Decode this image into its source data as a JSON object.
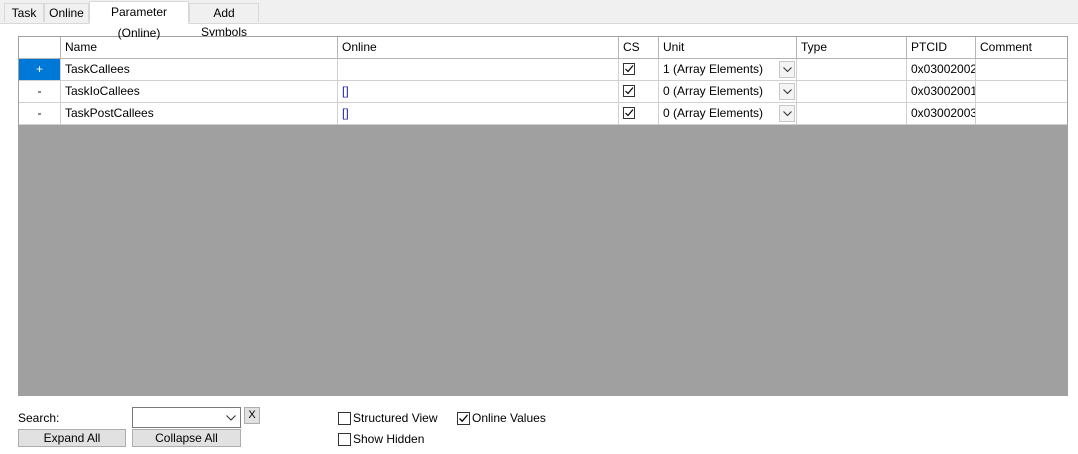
{
  "tabs": [
    {
      "label": "Task"
    },
    {
      "label": "Online"
    },
    {
      "label": "Parameter (Online)",
      "active": true
    },
    {
      "label": "Add Symbols"
    }
  ],
  "grid": {
    "columns": [
      "",
      "Name",
      "Online",
      "CS",
      "Unit",
      "Type",
      "PTCID",
      "Comment"
    ],
    "rows": [
      {
        "expander": "+",
        "name": "TaskCallees",
        "online": "",
        "cs": true,
        "unit": "1 (Array Elements)",
        "type": "",
        "ptcid": "0x03002002",
        "comment": "",
        "selected": true
      },
      {
        "expander": "-",
        "name": "TaskIoCallees",
        "online": "[]",
        "cs": true,
        "unit": "0 (Array Elements)",
        "type": "",
        "ptcid": "0x03002001",
        "comment": ""
      },
      {
        "expander": "-",
        "name": "TaskPostCallees",
        "online": "[]",
        "cs": true,
        "unit": "0 (Array Elements)",
        "type": "",
        "ptcid": "0x03002003",
        "comment": ""
      }
    ]
  },
  "bottom": {
    "search_label": "Search:",
    "search_value": "",
    "clear_label": "X",
    "expand_all": "Expand All",
    "collapse_all": "Collapse All",
    "structured_view": {
      "label": "Structured View",
      "checked": false
    },
    "show_hidden": {
      "label": "Show Hidden",
      "checked": false
    },
    "online_values": {
      "label": "Online Values",
      "checked": true
    }
  },
  "colors": {
    "selected_row_header": "#0078d7",
    "grid_background": "#a0a0a0",
    "online_value_text": "#1a1aa6"
  },
  "icons": [
    "chevron-down-icon",
    "checkmark-icon"
  ]
}
